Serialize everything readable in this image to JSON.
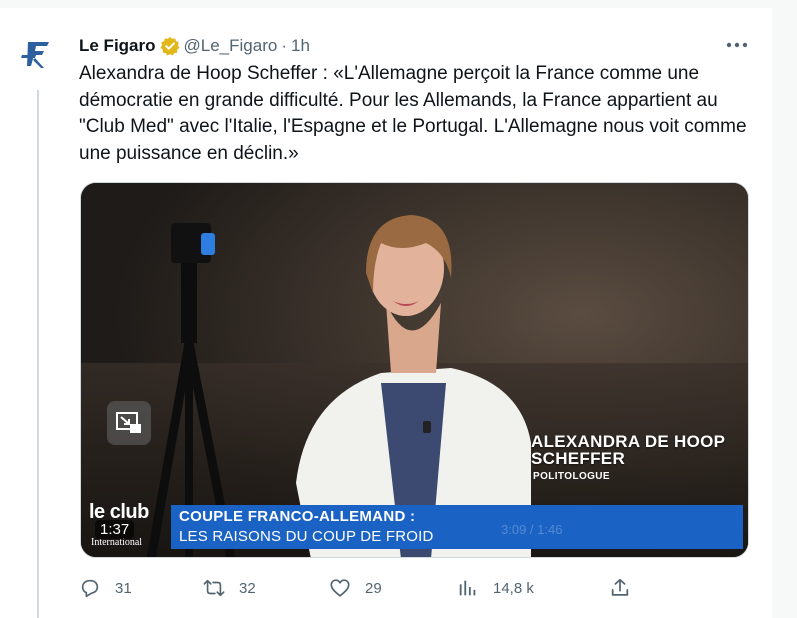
{
  "tweet": {
    "author_name": "Le Figaro",
    "handle": "@Le_Figaro",
    "separator": "·",
    "time": "1h",
    "text": "Alexandra de Hoop Scheffer : «L'Allemagne perçoit la France comme une démocratie en grande difficulté. Pour les Allemands, la France appartient au \"Club Med\" avec l'Italie, l'Espagne et le Portugal. L'Allemagne nous voit comme une puissance en déclin.»",
    "avatar_icon": "le-figaro-logo-icon",
    "verified_icon": "gold-verified-badge-icon",
    "more_icon": "more-icon"
  },
  "video": {
    "duration": "1:37",
    "logo_text": "le club",
    "logo_sub": "International",
    "banner_title": "COUPLE FRANCO-ALLEMAND :",
    "banner_subtitle": "LES RAISONS DU COUP DE FROID",
    "guest_name_line1": "ALEXANDRA DE HOOP",
    "guest_name_line2": "SCHEFFER",
    "guest_role": "POLITOLOGUE",
    "player_controls_text": "3:09 / 1:46"
  },
  "actions": {
    "replies": "31",
    "retweets": "32",
    "likes": "29",
    "views": "14,8 k"
  },
  "colors": {
    "accent": "#1d9bf0",
    "banner_blue": "#1a62c3",
    "secondary_text": "#536471",
    "verified_gold": "#e2b719",
    "figaro_blue": "#2e5f9e"
  }
}
